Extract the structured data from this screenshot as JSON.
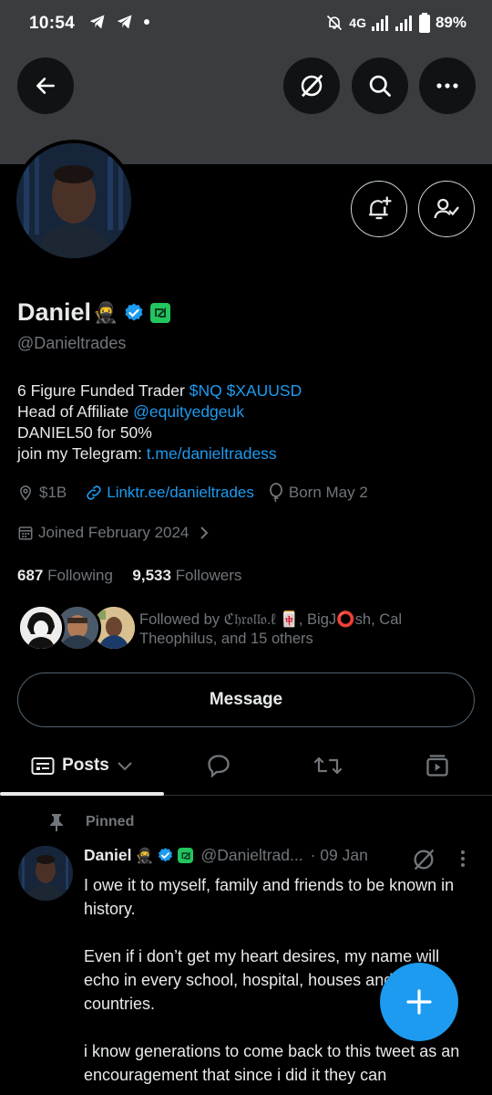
{
  "status_bar": {
    "time": "10:54",
    "network": "4G",
    "battery": "89%"
  },
  "profile": {
    "name": "Daniel",
    "name_emoji": "🥷",
    "handle": "@Danieltrades",
    "bio": {
      "line1_text": "6 Figure Funded Trader ",
      "line1_link": "$NQ $XAUUSD",
      "line2_text": "Head of Affiliate ",
      "line2_link": "@equityedgeuk",
      "line3_text": "DANIEL50 for 50%",
      "line4_text": "join my Telegram: ",
      "line4_link": "t.me/danieltradess"
    },
    "location": "$1B",
    "website": "Linktr.ee/danieltrades",
    "birthday": "Born May 2",
    "joined": "Joined February 2024",
    "following_count": "687",
    "following_label": "Following",
    "followers_count": "9,533",
    "followers_label": "Followers",
    "followed_by_prefix": "Followed by ",
    "followed_by_name1": "ℭ𝔥𝔯𝔬𝔩𝔩𝔬.ℓ 🀄",
    "followed_by_mid": ", BigJ⭕sh, Cal",
    "followed_by_line2": "Theophilus, and 15 others",
    "message_label": "Message"
  },
  "tabs": {
    "posts_label": "Posts"
  },
  "pinned_tweet": {
    "pinned_label": "Pinned",
    "name": "Daniel",
    "name_emoji": "🥷",
    "handle": "@Danieltrad...",
    "date": "· 09 Jan",
    "para1": "I owe it to myself, family and friends to be known in history.",
    "para2": "Even if i don’t get my heart desires, my name will echo in every school, hospital, houses and countries.",
    "para3": "i know generations to come back to this tweet as an encouragement that since i did it they can"
  },
  "colors": {
    "accent": "#1d9bf0",
    "verified_green": "#22c55e",
    "text_secondary": "#71767b"
  },
  "icons": [
    "back-arrow-icon",
    "grok-icon",
    "search-icon",
    "more-icon",
    "notify-plus-icon",
    "following-person-icon",
    "location-icon",
    "link-icon",
    "balloon-icon",
    "calendar-icon",
    "chevron-right-icon",
    "posts-icon",
    "chevron-down-icon",
    "replies-icon",
    "retweet-icon",
    "media-icon",
    "pin-icon",
    "plus-icon"
  ]
}
